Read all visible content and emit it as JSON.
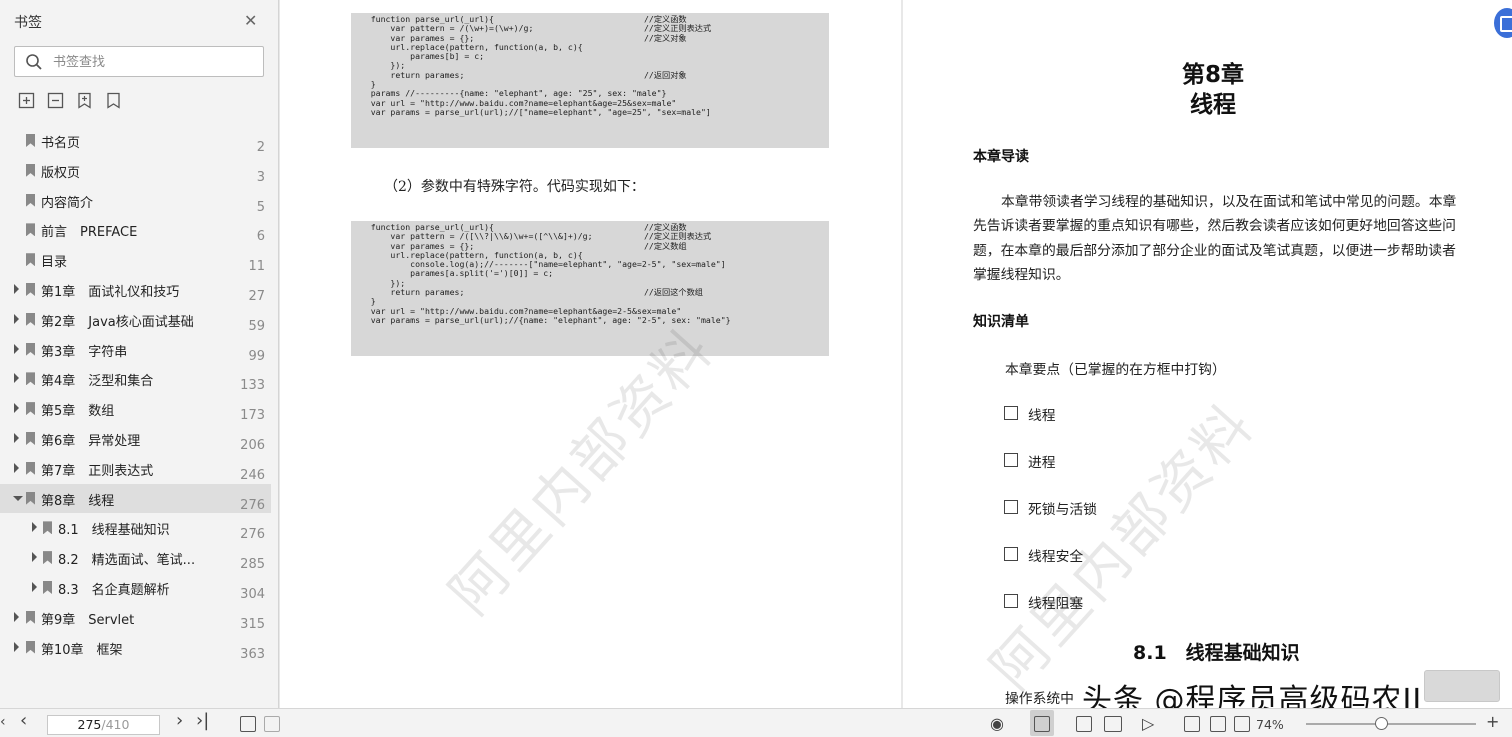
{
  "sidebar": {
    "title": "书签",
    "search_placeholder": "书签查找",
    "toc": [
      {
        "label": "书名页",
        "page": "2"
      },
      {
        "label": "版权页",
        "page": "3"
      },
      {
        "label": "内容简介",
        "page": "5"
      },
      {
        "label": "前言　PREFACE",
        "page": "6"
      },
      {
        "label": "目录",
        "page": "11"
      },
      {
        "label": "第1章　面试礼仪和技巧",
        "page": "27"
      },
      {
        "label": "第2章　Java核心面试基础",
        "page": "59"
      },
      {
        "label": "第3章　字符串",
        "page": "99"
      },
      {
        "label": "第4章　泛型和集合",
        "page": "133"
      },
      {
        "label": "第5章　数组",
        "page": "173"
      },
      {
        "label": "第6章　异常处理",
        "page": "206"
      },
      {
        "label": "第7章　正则表达式",
        "page": "246"
      },
      {
        "label": "第8章　线程",
        "page": "276"
      },
      {
        "label": "8.1　线程基础知识",
        "page": "276"
      },
      {
        "label": "8.2　精选面试、笔试...",
        "page": "285"
      },
      {
        "label": "8.3　名企真题解析",
        "page": "304"
      },
      {
        "label": "第9章　Servlet",
        "page": "315"
      },
      {
        "label": "第10章　框架",
        "page": "363"
      }
    ]
  },
  "left_page": {
    "code1": [
      {
        "code": "    function parse_url(_url){",
        "comment": "//定义函数"
      },
      {
        "code": "        var pattern = /(\\w+)=(\\w+)/g;",
        "comment": "//定义正则表达式"
      },
      {
        "code": "        var parames = {};",
        "comment": "//定义对象"
      },
      {
        "code": "        url.replace(pattern, function(a, b, c){",
        "comment": ""
      },
      {
        "code": "            parames[b] = c;",
        "comment": ""
      },
      {
        "code": "        });",
        "comment": ""
      },
      {
        "code": "        return parames;",
        "comment": "//返回对象"
      },
      {
        "code": "    }",
        "comment": ""
      },
      {
        "code": "    params //---------{name: \"elephant\", age: \"25\", sex: \"male\"}",
        "comment": ""
      },
      {
        "code": "    var url = \"http://www.baidu.com?name=elephant&age=25&sex=male\"",
        "comment": ""
      },
      {
        "code": "    var params = parse_url(url);//[\"name=elephant\", \"age=25\", \"sex=male\"]",
        "comment": ""
      }
    ],
    "paragraph": "（2）参数中有特殊字符。代码实现如下：",
    "code2": [
      {
        "code": "    function parse_url(_url){",
        "comment": "//定义函数"
      },
      {
        "code": "        var pattern = /([\\\\?|\\\\&)\\w+=([^\\\\&]+)/g;",
        "comment": "//定义正则表达式"
      },
      {
        "code": "        var parames = {};",
        "comment": "//定义数组"
      },
      {
        "code": "        url.replace(pattern, function(a, b, c){",
        "comment": ""
      },
      {
        "code": "            console.log(a);//-------[\"name=elephant\", \"age=2-5\", \"sex=male\"]",
        "comment": ""
      },
      {
        "code": "            parames[a.split('=')[0]] = c;",
        "comment": ""
      },
      {
        "code": "        });",
        "comment": ""
      },
      {
        "code": "        return parames;",
        "comment": "//返回这个数组"
      },
      {
        "code": "    }",
        "comment": ""
      },
      {
        "code": "    var url = \"http://www.baidu.com?name=elephant&age=2-5&sex=male\"",
        "comment": ""
      },
      {
        "code": "    var params = parse_url(url);//{name: \"elephant\", age: \"2-5\", sex: \"male\"}",
        "comment": ""
      }
    ],
    "watermark": "阿里内部资料"
  },
  "right_page": {
    "chapter_line1": "第8章",
    "chapter_line2": "线程",
    "intro_heading": "本章导读",
    "intro_text": "本章带领读者学习线程的基础知识，以及在面试和笔试中常见的问题。本章先告诉读者要掌握的重点知识有哪些，然后教会读者应该如何更好地回答这些问题，在本章的最后部分添加了部分企业的面试及笔试真题，以便进一步帮助读者掌握线程知识。",
    "checklist_heading": "知识清单",
    "checklist_intro": "本章要点（已掌握的在方框中打钩）",
    "checklist": [
      "线程",
      "进程",
      "死锁与活锁",
      "线程安全",
      "线程阻塞"
    ],
    "section_title": "8.1　线程基础知识",
    "bottom_text": "操作系统中",
    "watermark": "阿里内部资料",
    "overlay_brand": "头条 @程序员高级码农II"
  },
  "bottom_bar": {
    "current_page": "275",
    "total_pages": "/410",
    "zoom": "74%"
  }
}
